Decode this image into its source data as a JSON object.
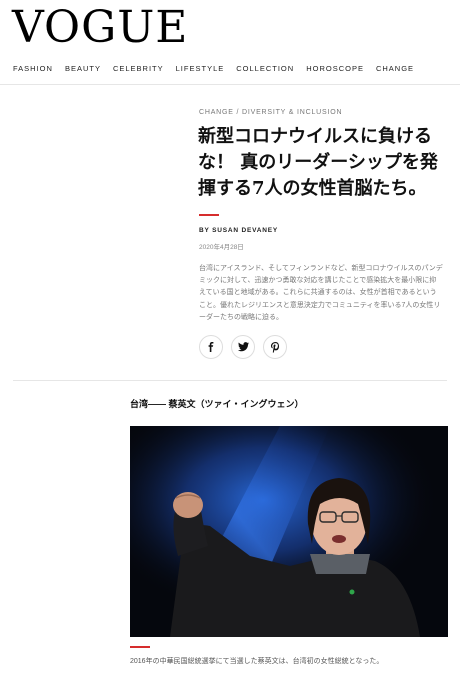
{
  "header": {
    "logo": "VOGUE",
    "nav": [
      "FASHION",
      "BEAUTY",
      "CELEBRITY",
      "LIFESTYLE",
      "COLLECTION",
      "HOROSCOPE",
      "CHANGE"
    ]
  },
  "article": {
    "kicker_primary": "CHANGE",
    "kicker_separator": "/",
    "kicker_secondary": "DIVERSITY & INCLUSION",
    "headline": "新型コロナウイルスに負けるな！ 真のリーダーシップを発揮する7人の女性首脳たち。",
    "byline": "BY SUSAN DEVANEY",
    "date": "2020年4月28日",
    "lede": "台湾にアイスランド、そしてフィンランドなど、新型コロナウイルスのパンデミックに対して、迅速かつ勇敢な対応を講じたことで感染拡大を最小限に抑えている国と地域がある。これらに共通するのは、女性が首相であるということ。優れたレジリエンスと意思決定力でコミュニティを率いる7人の女性リーダーたちの戦略に迫る。",
    "share_icons": [
      "facebook-icon",
      "twitter-icon",
      "pinterest-icon"
    ]
  },
  "section": {
    "title": "台湾—— 蔡英文（ツァイ・イングウェン）",
    "caption": "2016年の中華民国総統選挙にて当選した蔡英文は、台湾初の女性総統となった。"
  },
  "colors": {
    "accent_red": "#d62d2d",
    "photo_bg": "#05070d",
    "photo_light": "#1d4fb8"
  }
}
